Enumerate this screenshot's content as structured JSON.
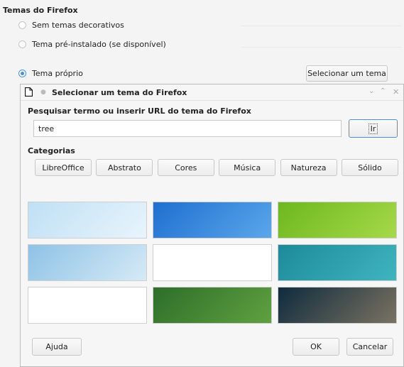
{
  "background": {
    "section_title": "Temas do Firefox",
    "option_none": "Sem temas decorativos",
    "option_preinstalled": "Tema pré-instalado (se disponível)",
    "option_own": "Tema próprio",
    "select_theme_button": "Selecionar um tema"
  },
  "dialog": {
    "title": "Selecionar um tema do Firefox",
    "search_label": "Pesquisar termo ou inserir URL do tema do Firefox",
    "search_value": "tree",
    "go_button": "Ir",
    "categories_label": "Categorias",
    "categories": [
      "LibreOffice",
      "Abstrato",
      "Cores",
      "Música",
      "Natureza",
      "Sólido"
    ],
    "help_button": "Ajuda",
    "ok_button": "OK",
    "cancel_button": "Cancelar",
    "themes": [
      {
        "name": "sky-clouds",
        "colors": [
          "#bfe0f4",
          "#e8f4fc"
        ]
      },
      {
        "name": "blue-flower",
        "colors": [
          "#1f6fd0",
          "#5aa7ea"
        ]
      },
      {
        "name": "green-leaf",
        "colors": [
          "#6db81e",
          "#a6d94a"
        ]
      },
      {
        "name": "clouds-blue",
        "colors": [
          "#8ec2e6",
          "#d6eaf6"
        ]
      },
      {
        "name": "white-blank",
        "colors": [
          "#ffffff",
          "#ffffff"
        ]
      },
      {
        "name": "teal-vine",
        "colors": [
          "#1d8a9a",
          "#3fb5bf"
        ]
      },
      {
        "name": "white-blank-2",
        "colors": [
          "#ffffff",
          "#ffffff"
        ]
      },
      {
        "name": "water-drops",
        "colors": [
          "#2d6e2a",
          "#5fa13f"
        ]
      },
      {
        "name": "dark-horizon",
        "colors": [
          "#0f2b3d",
          "#7a7261"
        ]
      }
    ]
  }
}
